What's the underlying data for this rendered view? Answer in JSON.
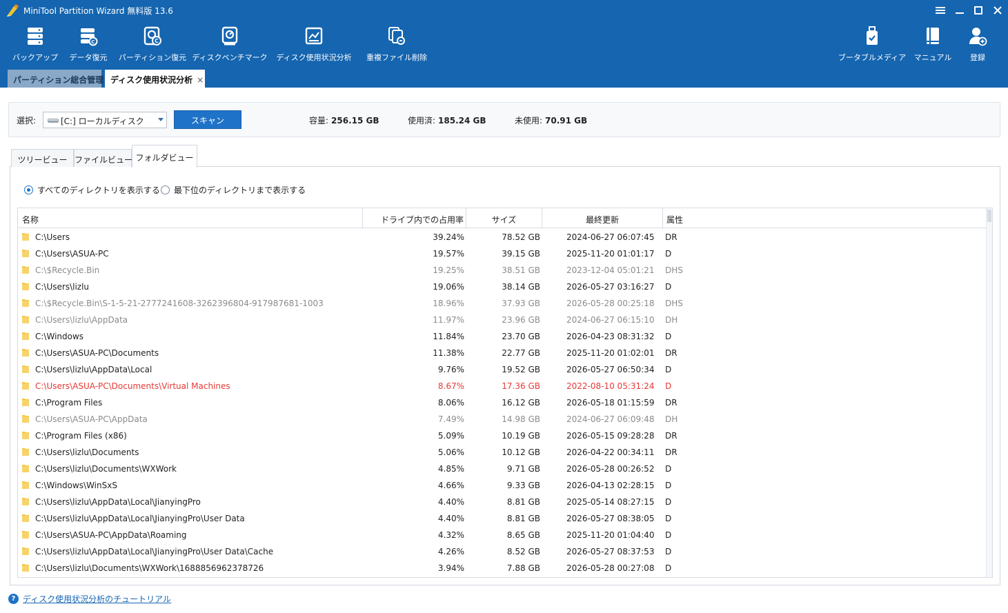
{
  "window": {
    "title": "MiniTool Partition Wizard 無料版 13.6"
  },
  "toolbar": {
    "left": [
      {
        "label": "バックアップ",
        "icon": "backup-icon"
      },
      {
        "label": "データ復元",
        "icon": "data-recovery-icon"
      },
      {
        "label": "パーティション復元",
        "icon": "partition-recovery-icon"
      },
      {
        "label": "ディスクベンチマーク",
        "icon": "disk-benchmark-icon"
      },
      {
        "label": "ディスク使用状況分析",
        "icon": "space-analyzer-icon"
      },
      {
        "label": "重複ファイル削除",
        "icon": "duplicate-file-icon"
      }
    ],
    "right": [
      {
        "label": "ブータブルメディア",
        "icon": "bootable-media-icon"
      },
      {
        "label": "マニュアル",
        "icon": "manual-icon"
      },
      {
        "label": "登録",
        "icon": "register-icon"
      }
    ]
  },
  "tabs": [
    {
      "label": "パーティション総合管理",
      "active": false
    },
    {
      "label": "ディスク使用状況分析",
      "active": true,
      "close": "×"
    }
  ],
  "selector": {
    "label": "選択:",
    "drive": "[C:] ローカルディスク",
    "scan_label": "スキャン",
    "capacity_label": "容量:",
    "capacity": "256.15 GB",
    "used_label": "使用済:",
    "used": "185.24 GB",
    "free_label": "未使用:",
    "free": "70.91 GB"
  },
  "subtabs": [
    {
      "label": "ツリービュー",
      "active": false
    },
    {
      "label": "ファイルビュー",
      "active": false
    },
    {
      "label": "フォルダビュー",
      "active": true
    }
  ],
  "radios": [
    {
      "label": "すべてのディレクトリを表示する",
      "checked": true
    },
    {
      "label": "最下位のディレクトリまで表示する",
      "checked": false
    }
  ],
  "table": {
    "columns": {
      "name": "名称",
      "pct": "ドライブ内での占用率",
      "size": "サイズ",
      "date": "最終更新",
      "attr": "属性"
    },
    "rows": [
      {
        "name": "C:\\Users",
        "pct": "39.24%",
        "size": "78.52 GB",
        "date": "2024-06-27 06:07:45",
        "attr": "DR",
        "state": "normal"
      },
      {
        "name": "C:\\Users\\ASUA-PC",
        "pct": "19.57%",
        "size": "39.15 GB",
        "date": "2025-11-20 01:01:17",
        "attr": "D",
        "state": "normal"
      },
      {
        "name": "C:\\$Recycle.Bin",
        "pct": "19.25%",
        "size": "38.51 GB",
        "date": "2023-12-04 05:01:21",
        "attr": "DHS",
        "state": "hidden"
      },
      {
        "name": "C:\\Users\\lizlu",
        "pct": "19.06%",
        "size": "38.14 GB",
        "date": "2026-05-27 03:16:27",
        "attr": "D",
        "state": "normal"
      },
      {
        "name": "C:\\$Recycle.Bin\\S-1-5-21-2777241608-3262396804-917987681-1003",
        "pct": "18.96%",
        "size": "37.93 GB",
        "date": "2026-05-28 00:25:18",
        "attr": "DHS",
        "state": "hidden"
      },
      {
        "name": "C:\\Users\\lizlu\\AppData",
        "pct": "11.97%",
        "size": "23.96 GB",
        "date": "2024-06-27 06:15:10",
        "attr": "DH",
        "state": "hidden"
      },
      {
        "name": "C:\\Windows",
        "pct": "11.84%",
        "size": "23.70 GB",
        "date": "2026-04-23 08:31:32",
        "attr": "D",
        "state": "normal"
      },
      {
        "name": "C:\\Users\\ASUA-PC\\Documents",
        "pct": "11.38%",
        "size": "22.77 GB",
        "date": "2025-11-20 01:02:01",
        "attr": "DR",
        "state": "normal"
      },
      {
        "name": "C:\\Users\\lizlu\\AppData\\Local",
        "pct": "9.76%",
        "size": "19.52 GB",
        "date": "2026-05-27 06:50:34",
        "attr": "D",
        "state": "normal"
      },
      {
        "name": "C:\\Users\\ASUA-PC\\Documents\\Virtual Machines",
        "pct": "8.67%",
        "size": "17.36 GB",
        "date": "2022-08-10 05:31:24",
        "attr": "D",
        "state": "deleted"
      },
      {
        "name": "C:\\Program Files",
        "pct": "8.06%",
        "size": "16.12 GB",
        "date": "2026-05-18 01:15:59",
        "attr": "DR",
        "state": "normal"
      },
      {
        "name": "C:\\Users\\ASUA-PC\\AppData",
        "pct": "7.49%",
        "size": "14.98 GB",
        "date": "2024-06-27 06:09:48",
        "attr": "DH",
        "state": "hidden"
      },
      {
        "name": "C:\\Program Files (x86)",
        "pct": "5.09%",
        "size": "10.19 GB",
        "date": "2026-05-15 09:28:28",
        "attr": "DR",
        "state": "normal"
      },
      {
        "name": "C:\\Users\\lizlu\\Documents",
        "pct": "5.06%",
        "size": "10.12 GB",
        "date": "2026-04-22 00:34:11",
        "attr": "DR",
        "state": "normal"
      },
      {
        "name": "C:\\Users\\lizlu\\Documents\\WXWork",
        "pct": "4.85%",
        "size": "9.71 GB",
        "date": "2026-05-28 00:26:52",
        "attr": "D",
        "state": "normal"
      },
      {
        "name": "C:\\Windows\\WinSxS",
        "pct": "4.66%",
        "size": "9.33 GB",
        "date": "2026-04-13 02:28:15",
        "attr": "D",
        "state": "normal"
      },
      {
        "name": "C:\\Users\\lizlu\\AppData\\Local\\JianyingPro",
        "pct": "4.40%",
        "size": "8.81 GB",
        "date": "2025-05-14 08:27:15",
        "attr": "D",
        "state": "normal"
      },
      {
        "name": "C:\\Users\\lizlu\\AppData\\Local\\JianyingPro\\User Data",
        "pct": "4.40%",
        "size": "8.81 GB",
        "date": "2026-05-27 08:38:05",
        "attr": "D",
        "state": "normal"
      },
      {
        "name": "C:\\Users\\ASUA-PC\\AppData\\Roaming",
        "pct": "4.32%",
        "size": "8.65 GB",
        "date": "2025-11-20 01:04:40",
        "attr": "D",
        "state": "normal"
      },
      {
        "name": "C:\\Users\\lizlu\\AppData\\Local\\JianyingPro\\User Data\\Cache",
        "pct": "4.26%",
        "size": "8.52 GB",
        "date": "2026-05-27 08:37:53",
        "attr": "D",
        "state": "normal"
      },
      {
        "name": "C:\\Users\\lizlu\\Documents\\WXWork\\1688856962378726",
        "pct": "3.94%",
        "size": "7.88 GB",
        "date": "2026-05-28 00:27:08",
        "attr": "D",
        "state": "normal"
      }
    ]
  },
  "footer": {
    "help_icon": "?",
    "link": "ディスク使用状況分析のチュートリアル"
  },
  "colors": {
    "toolbar_bg": "#1565b0",
    "accent": "#1e73c8",
    "deleted_text": "#e53935",
    "hidden_text": "#8b8b8b",
    "folder": "#f5c542"
  }
}
